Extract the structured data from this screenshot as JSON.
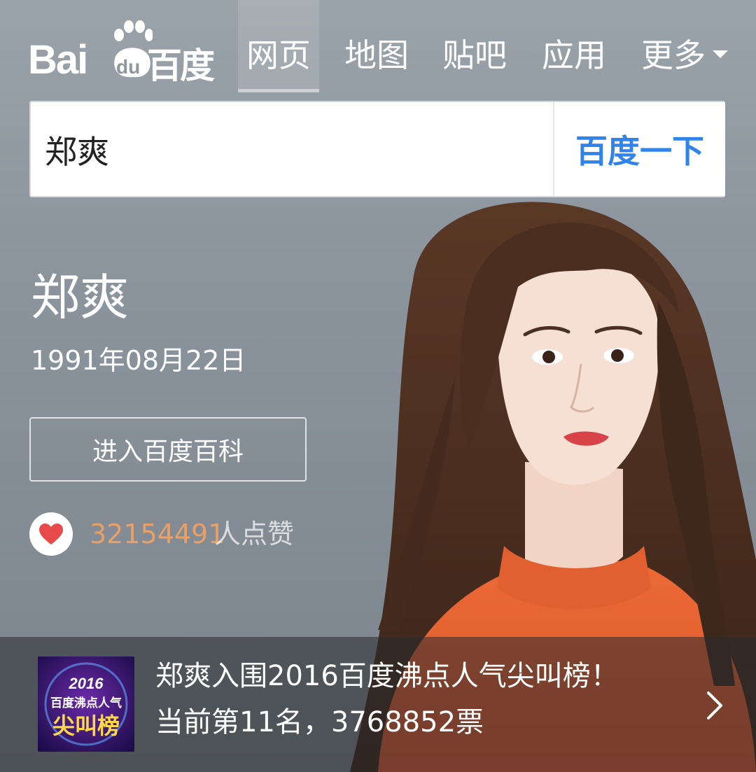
{
  "nav": {
    "logo": {
      "bai": "Bai",
      "du": "du",
      "cn": "百度"
    },
    "tabs": [
      {
        "label": "网页",
        "active": true
      },
      {
        "label": "地图",
        "active": false
      },
      {
        "label": "贴吧",
        "active": false
      },
      {
        "label": "应用",
        "active": false
      },
      {
        "label": "更多",
        "active": false
      }
    ]
  },
  "search": {
    "value": "郑爽",
    "button_label": "百度一下"
  },
  "profile": {
    "name": "郑爽",
    "birthdate": "1991年08月22日",
    "baike_button": "进入百度百科",
    "likes_count": "32154491",
    "likes_suffix": "人点赞"
  },
  "banner": {
    "badge": {
      "year": "2016",
      "line1": "百度沸点人气",
      "line2": "尖叫榜"
    },
    "line1": "郑爽入围2016百度沸点人气尖叫榜！",
    "line2": "当前第11名，3768852票"
  },
  "colors": {
    "accent_blue": "#3083e8",
    "like_orange": "#e8a067",
    "heart_red": "#e84a4a",
    "sweater_orange": "#e8612e"
  }
}
